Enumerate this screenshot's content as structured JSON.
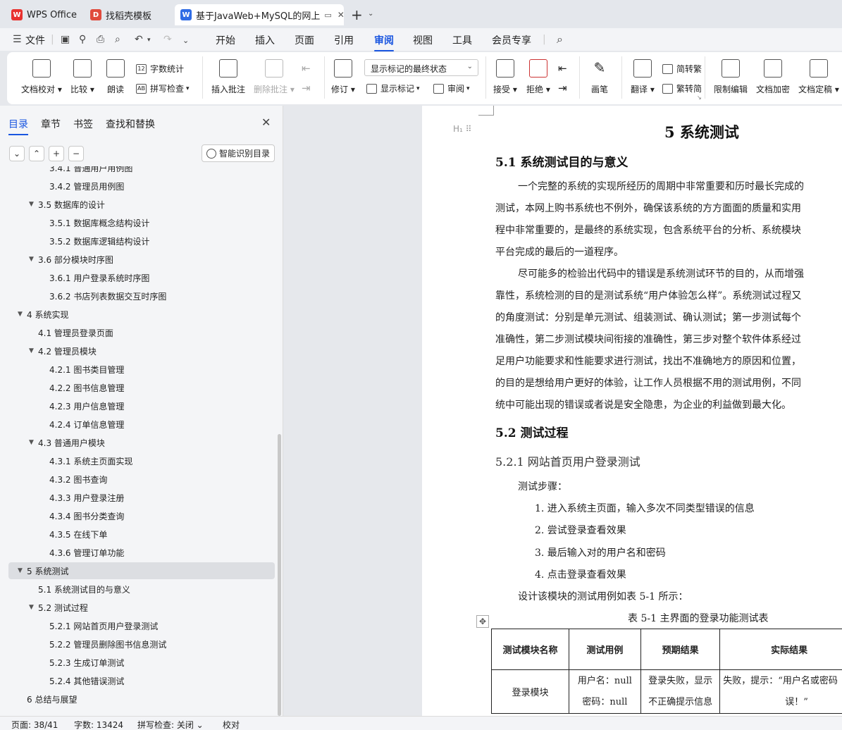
{
  "tabs": [
    {
      "label": "WPS Office",
      "icon": "wps-logo-icon",
      "active": false
    },
    {
      "label": "找稻壳模板",
      "icon": "docer-icon",
      "active": false
    },
    {
      "label": "基于JavaWeb+MySQL的网上",
      "icon": "wps-writer-icon",
      "active": true
    }
  ],
  "menu": {
    "file": "文件",
    "items": [
      "开始",
      "插入",
      "页面",
      "引用",
      "审阅",
      "视图",
      "工具",
      "会员专享"
    ],
    "active": "审阅"
  },
  "ribbon": {
    "doc_check": "文档校对",
    "compare": "比较",
    "read_aloud": "朗读",
    "word_count": "字数统计",
    "spell_check": "拼写检查",
    "insert_comment": "插入批注",
    "delete_comment": "删除批注",
    "revise": "修订",
    "markup_state": "显示标记的最终状态",
    "show_markup": "显示标记",
    "review_pane": "审阅",
    "accept": "接受",
    "reject": "拒绝",
    "pen": "画笔",
    "translate": "翻译",
    "to_traditional": "简转繁",
    "to_simplified": "繁转简",
    "restrict_edit": "限制编辑",
    "encrypt": "文档加密",
    "finalize": "文档定稿"
  },
  "nav": {
    "tabs": [
      "目录",
      "章节",
      "书签",
      "查找和替换"
    ],
    "active_tab": "目录",
    "smart_btn": "智能识别目录",
    "toc": [
      {
        "label": "3.4.1  普通用户用例图",
        "level": 3,
        "arrow": false
      },
      {
        "label": "3.4.2  管理员用例图",
        "level": 3,
        "arrow": false
      },
      {
        "label": "3.5  数据库的设计",
        "level": 2,
        "arrow": true
      },
      {
        "label": "3.5.1  数据库概念结构设计",
        "level": 3,
        "arrow": false
      },
      {
        "label": "3.5.2  数据库逻辑结构设计",
        "level": 3,
        "arrow": false
      },
      {
        "label": "3.6  部分模块时序图",
        "level": 2,
        "arrow": true
      },
      {
        "label": "3.6.1  用户登录系统时序图",
        "level": 3,
        "arrow": false
      },
      {
        "label": "3.6.2  书店列表数据交互时序图",
        "level": 3,
        "arrow": false
      },
      {
        "label": "4  系统实现",
        "level": 1,
        "arrow": true
      },
      {
        "label": "4.1  管理员登录页面",
        "level": 2,
        "arrow": false
      },
      {
        "label": "4.2  管理员模块",
        "level": 2,
        "arrow": true
      },
      {
        "label": "4.2.1  图书类目管理",
        "level": 3,
        "arrow": false
      },
      {
        "label": "4.2.2  图书信息管理",
        "level": 3,
        "arrow": false
      },
      {
        "label": "4.2.3  用户信息管理",
        "level": 3,
        "arrow": false
      },
      {
        "label": "4.2.4  订单信息管理",
        "level": 3,
        "arrow": false
      },
      {
        "label": "4.3  普通用户模块",
        "level": 2,
        "arrow": true
      },
      {
        "label": "4.3.1  系统主页面实现",
        "level": 3,
        "arrow": false
      },
      {
        "label": "4.3.2  图书查询",
        "level": 3,
        "arrow": false
      },
      {
        "label": "4.3.3  用户登录注册",
        "level": 3,
        "arrow": false
      },
      {
        "label": "4.3.4  图书分类查询",
        "level": 3,
        "arrow": false
      },
      {
        "label": "4.3.5  在线下单",
        "level": 3,
        "arrow": false
      },
      {
        "label": "4.3.6  管理订单功能",
        "level": 3,
        "arrow": false
      },
      {
        "label": "5  系统测试",
        "level": 1,
        "arrow": true,
        "selected": true
      },
      {
        "label": "5.1  系统测试目的与意义",
        "level": 2,
        "arrow": false
      },
      {
        "label": "5.2  测试过程",
        "level": 2,
        "arrow": true
      },
      {
        "label": "5.2.1  网站首页用户登录测试",
        "level": 3,
        "arrow": false
      },
      {
        "label": "5.2.2  管理员删除图书信息测试",
        "level": 3,
        "arrow": false
      },
      {
        "label": "5.2.3  生成订单测试",
        "level": 3,
        "arrow": false
      },
      {
        "label": "5.2.4  其他错误测试",
        "level": 3,
        "arrow": false
      },
      {
        "label": "6  总结与展望",
        "level": 1,
        "arrow": false
      }
    ]
  },
  "document": {
    "chapter_title": "5  系统测试",
    "s51_title": "5.1  系统测试目的与意义",
    "p1": [
      "一个完整的系统的实现所经历的周期中非常重要和历时最长完成的",
      "测试，本网上购书系统也不例外，确保该系统的方方面面的质量和实用",
      "程中非常重要的，是最终的系统实现，包含系统平台的分析、系统模块",
      "平台完成的最后的一道程序。"
    ],
    "p2": [
      "尽可能多的检验出代码中的错误是系统测试环节的目的，从而增强",
      "靠性，系统检测的目的是测试系统“用户体验怎么样”。系统测试过程又",
      "的角度测试：分别是单元测试、组装测试、确认测试；第一步测试每个",
      "准确性，第二步测试模块间衔接的准确性，第三步对整个软件体系经过",
      "足用户功能要求和性能要求进行测试，找出不准确地方的原因和位置，",
      "的目的是想给用户更好的体验，让工作人员根据不用的测试用例，不同",
      "统中可能出现的错误或者说是安全隐患，为企业的利益做到最大化。"
    ],
    "s52_title": "5.2  测试过程",
    "s521_title": "5.2.1  网站首页用户登录测试",
    "steps_label": "测试步骤：",
    "steps": [
      "1.  进入系统主页面，输入多次不同类型错误的信息",
      "2.  尝试登录查看效果",
      "3.  最后输入对的用户名和密码",
      "4.  点击登录查看效果"
    ],
    "table_intro": "设计该模块的测试用例如表 5-1 所示：",
    "table_caption": "表 5-1  主界面的登录功能测试表",
    "table": {
      "headers": [
        "测试模块名称",
        "测试用例",
        "预期结果",
        "实际结果"
      ],
      "row": {
        "module": "登录模块",
        "case_line1": "用户名：null",
        "case_line2": "密码：null",
        "expected_line1": "登录失败，显示",
        "expected_line2": "不正确提示信息",
        "actual_line1": "失败，提示：“用户名或密码",
        "actual_line2": "误！”"
      }
    }
  },
  "status": {
    "page": "页面: 38/41",
    "words": "字数: 13424",
    "spell": "拼写检查: 关闭",
    "proof": "校对"
  },
  "colors": {
    "accent": "#1a56e0",
    "wps_red": "#e8322f",
    "writer_blue": "#2f6ce5",
    "docer_red": "#e04a3c"
  }
}
